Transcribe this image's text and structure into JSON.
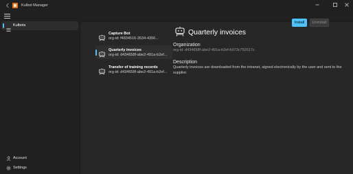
{
  "app": {
    "title": "Kulbot Manager",
    "accent_color": "#4cc2ff",
    "logo_color": "#e8751a"
  },
  "titlebar": {
    "back_icon": "arrow-left-icon",
    "minimize_glyph": "–",
    "maximize_glyph": "□",
    "close_glyph": "✕"
  },
  "sidebar": {
    "items": [
      {
        "label": "Kulbots",
        "icon": "list-icon",
        "selected": true
      }
    ],
    "footer": [
      {
        "label": "Account",
        "icon": "person-icon",
        "glyph": "👤"
      },
      {
        "label": "Settings",
        "icon": "gear-icon",
        "glyph": "⚙"
      }
    ]
  },
  "bots": [
    {
      "name": "Capture Bot",
      "org": "org-id: f4834516-3534-4356...",
      "selected": false
    },
    {
      "name": "Quarterly invoices",
      "org": "org-id: d434658f-abe2-491a-b2ef...",
      "selected": true
    },
    {
      "name": "Transfer of training records",
      "org": "org-id: d434658f-abe2-491a-b2ef...",
      "selected": false
    }
  ],
  "detail": {
    "title": "Quarterly invoices",
    "organization_label": "Organization",
    "organization_value": "org-id: d434658f-abe2-491a-b2ef-b073c752617c",
    "description_label": "Description",
    "description_value": "Quarterly invoices are downloaded from the intranet, signed electronically by the user and sent to the supplier.",
    "install_label": "Install",
    "uninstall_label": "Uninstall"
  }
}
